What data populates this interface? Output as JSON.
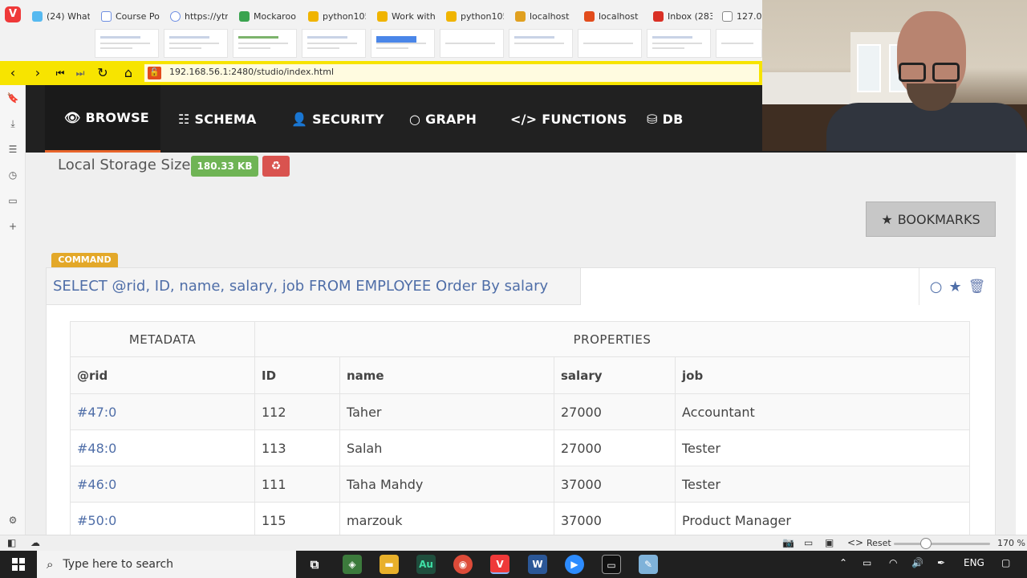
{
  "browser": {
    "tabs": [
      {
        "label": "(24) What",
        "color": "#56b9f0"
      },
      {
        "label": "Course Po",
        "color": "#6f8fe2"
      },
      {
        "label": "https://ytr",
        "color": "#6f8fe2"
      },
      {
        "label": "Mockaroo",
        "color": "#3aa34f"
      },
      {
        "label": "python105",
        "color": "#f0b400"
      },
      {
        "label": "Work with",
        "color": "#f0b400"
      },
      {
        "label": "python105",
        "color": "#f0b400"
      },
      {
        "label": "localhost",
        "color": "#e0a020"
      },
      {
        "label": "localhost",
        "color": "#e24c1c"
      },
      {
        "label": "Inbox (283",
        "color": "#d93025"
      },
      {
        "label": "127.0.",
        "color": "#888888"
      }
    ],
    "url": "192.168.56.1:2480/studio/index.html"
  },
  "studio_nav": {
    "items": [
      {
        "label": "BROWSE",
        "icon": "eye-icon"
      },
      {
        "label": "SCHEMA",
        "icon": "table-icon"
      },
      {
        "label": "SECURITY",
        "icon": "user-icon"
      },
      {
        "label": "GRAPH",
        "icon": "circle-icon"
      },
      {
        "label": "FUNCTIONS",
        "icon": "code-icon"
      },
      {
        "label": "DB",
        "icon": "database-icon"
      }
    ],
    "active": "BROWSE"
  },
  "storage": {
    "label": "Local Storage Size",
    "size": "180.33 KB"
  },
  "bookmarks_label": "BOOKMARKS",
  "command": {
    "tag": "COMMAND",
    "query": "SELECT @rid, ID, name, salary, job FROM EMPLOYEE Order By salary"
  },
  "result_table": {
    "groups": [
      "METADATA",
      "PROPERTIES"
    ],
    "columns": [
      "@rid",
      "ID",
      "name",
      "salary",
      "job"
    ],
    "rows": [
      [
        "#47:0",
        "112",
        "Taher",
        "27000",
        "Accountant"
      ],
      [
        "#48:0",
        "113",
        "Salah",
        "27000",
        "Tester"
      ],
      [
        "#46:0",
        "111",
        "Taha Mahdy",
        "37000",
        "Tester"
      ],
      [
        "#50:0",
        "115",
        "marzouk",
        "37000",
        "Product Manager"
      ]
    ]
  },
  "statusbar": {
    "reset_label": "Reset",
    "zoom": "170 %"
  },
  "taskbar": {
    "search_placeholder": "Type here to search",
    "language": "ENG"
  }
}
